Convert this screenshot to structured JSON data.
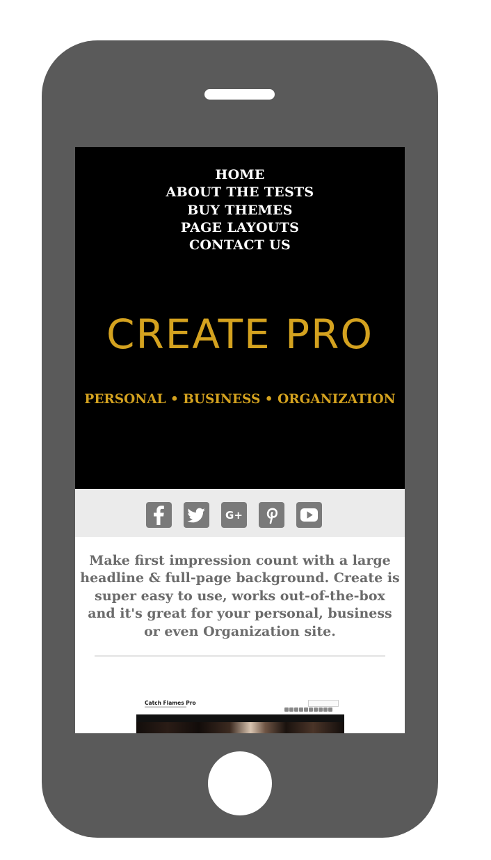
{
  "nav": {
    "items": [
      {
        "label": "HOME"
      },
      {
        "label": "ABOUT THE TESTS"
      },
      {
        "label": "BUY THEMES"
      },
      {
        "label": "PAGE LAYOUTS"
      },
      {
        "label": "CONTACT US"
      }
    ]
  },
  "hero": {
    "title": "CREATE PRO",
    "tagline": "PERSONAL • BUSINESS • ORGANIZATION"
  },
  "social": {
    "icons": [
      "facebook-icon",
      "twitter-icon",
      "google-plus-icon",
      "pinterest-icon",
      "youtube-icon"
    ]
  },
  "intro": {
    "lines": [
      "Make first impression count with a large",
      "headline & full-page background. Create is",
      "super easy to use, works out-of-the-box",
      "and it's great for your personal, business",
      "or even Organization site."
    ]
  },
  "preview": {
    "site_title": "Catch Flames Pro"
  },
  "colors": {
    "accent": "#d4a21f",
    "phone_body": "#5a5a5a",
    "hero_bg": "#000000",
    "social_bar_bg": "#ebebeb",
    "icon_gray": "#7a7a7a",
    "text_gray": "#6b6b6b"
  }
}
